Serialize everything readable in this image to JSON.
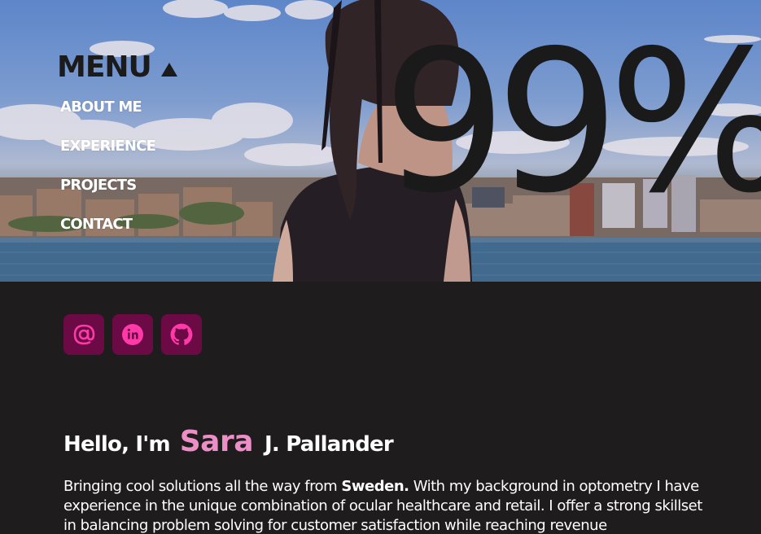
{
  "hero": {
    "big_stat": "99%"
  },
  "menu": {
    "title": "MENU",
    "items": [
      {
        "label": "ABOUT ME"
      },
      {
        "label": "EXPERIENCE"
      },
      {
        "label": "PROJECTS"
      },
      {
        "label": "CONTACT"
      }
    ]
  },
  "socials": [
    {
      "icon": "at-sign-icon",
      "label": "Email"
    },
    {
      "icon": "linkedin-icon",
      "label": "LinkedIn"
    },
    {
      "icon": "github-icon",
      "label": "GitHub"
    }
  ],
  "intro": {
    "greeting": "Hello, I'm",
    "first_name": "Sara",
    "last_name": "J. Pallander",
    "bio_part1": "Bringing cool solutions all the way from ",
    "bio_bold": "Sweden.",
    "bio_part2": " With my background in optometry I have experience in the unique combination of ocular healthcare and retail. I offer a strong skillset in balancing problem solving for customer satisfaction while reaching revenue"
  },
  "colors": {
    "accent_pink": "#ec8fc7",
    "social_bg": "#6c0a45",
    "social_icon": "#ff3aa8",
    "dark_bg": "#1e1c1c"
  }
}
